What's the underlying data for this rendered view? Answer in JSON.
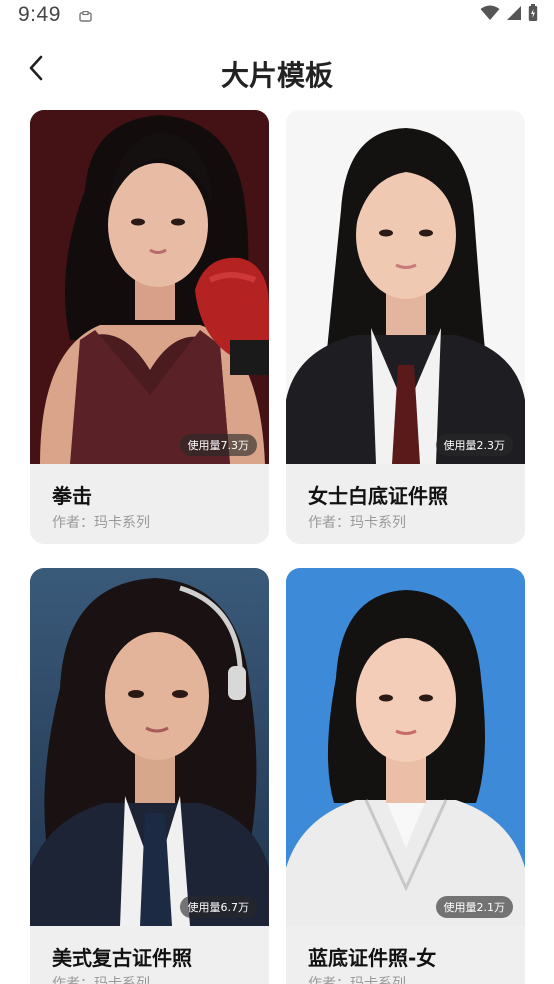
{
  "status": {
    "time": "9:49"
  },
  "header": {
    "title": "大片模板"
  },
  "cards": [
    {
      "title": "拳击",
      "author": "作者：玛卡系列",
      "usage": "使用量7.3万",
      "bg": "#3a0e10"
    },
    {
      "title": "女士白底证件照",
      "author": "作者：玛卡系列",
      "usage": "使用量2.3万",
      "bg": "#f6f6f6"
    },
    {
      "title": "美式复古证件照",
      "author": "作者：玛卡系列",
      "usage": "使用量6.7万",
      "bg": "#2d4a6a"
    },
    {
      "title": "蓝底证件照-女",
      "author": "作者：玛卡系列",
      "usage": "使用量2.1万",
      "bg": "#3d8ad8"
    }
  ]
}
